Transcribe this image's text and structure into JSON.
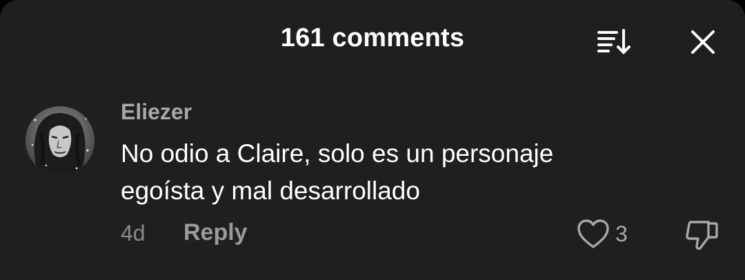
{
  "header": {
    "title": "161 comments",
    "icons": {
      "sort": "sort-icon",
      "close": "close-icon"
    }
  },
  "comment": {
    "username": "Eliezer",
    "text_lines": [
      "No odio a Claire, solo es un personaje",
      "egoísta y mal desarrollado"
    ],
    "timestamp": "4d",
    "reply_label": "Reply",
    "like_count": "3",
    "icons": {
      "avatar": "avatar-image",
      "like": "heart-icon",
      "dislike": "thumbs-down-icon"
    }
  },
  "colors": {
    "sheet_background": "#1f1f1f",
    "primary_text": "#ffffff",
    "secondary_text": "#a8a8a8"
  }
}
